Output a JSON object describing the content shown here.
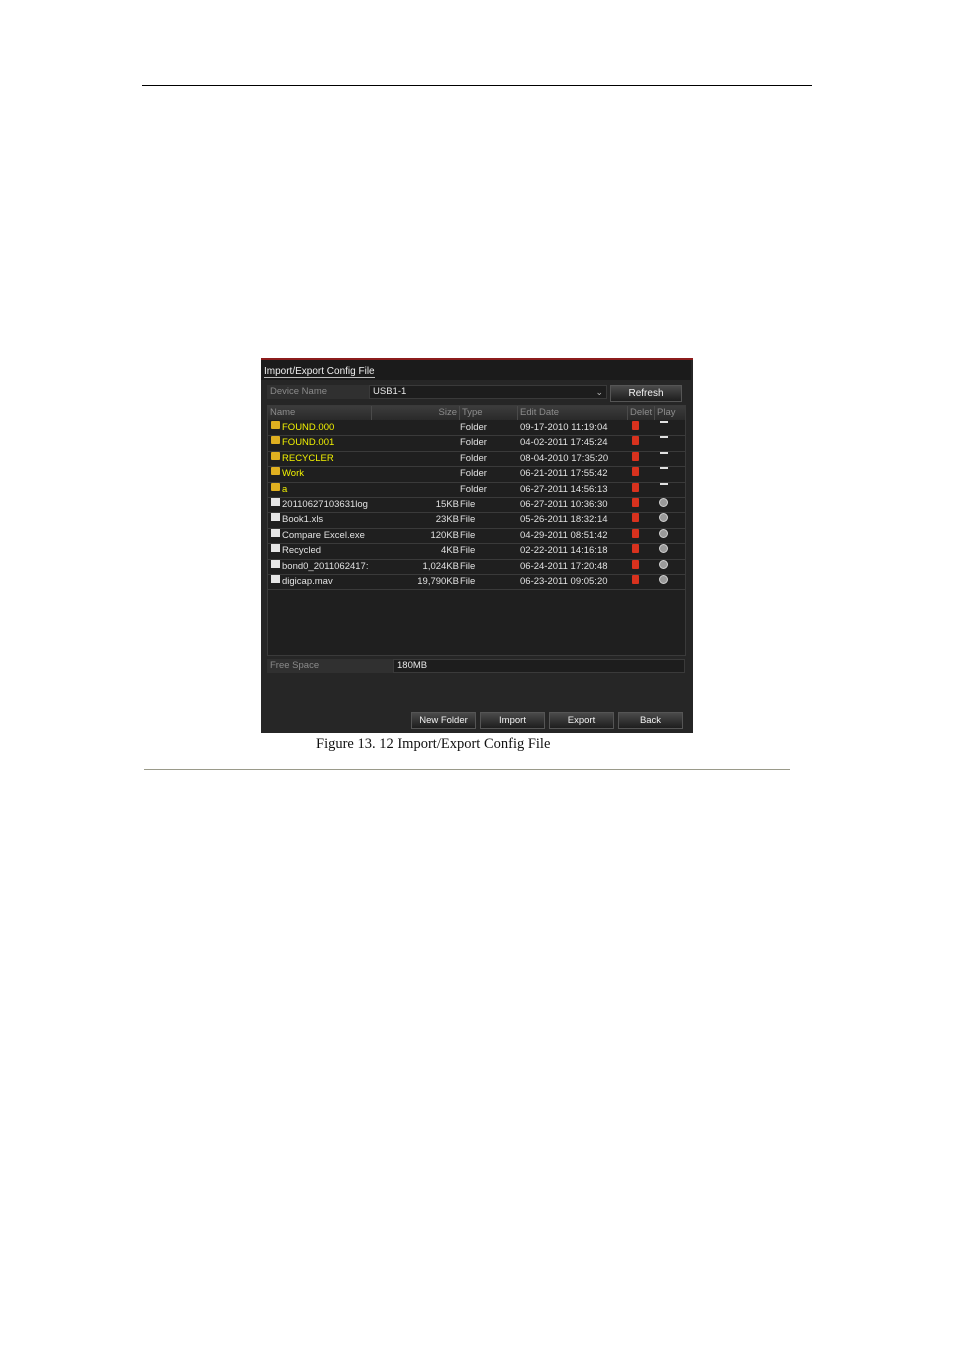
{
  "dialog": {
    "title": "Import/Export Config File",
    "device_label": "Device Name",
    "device_value": "USB1-1",
    "refresh_label": "Refresh",
    "columns": [
      "Name",
      "Size",
      "Type",
      "Edit Date",
      "Delet",
      "Play"
    ],
    "rows": [
      {
        "name": "FOUND.000",
        "size": "",
        "type": "Folder",
        "date": "09-17-2010 11:19:04",
        "kind": "folder"
      },
      {
        "name": "FOUND.001",
        "size": "",
        "type": "Folder",
        "date": "04-02-2011 17:45:24",
        "kind": "folder"
      },
      {
        "name": "RECYCLER",
        "size": "",
        "type": "Folder",
        "date": "08-04-2010 17:35:20",
        "kind": "folder"
      },
      {
        "name": "Work",
        "size": "",
        "type": "Folder",
        "date": "06-21-2011 17:55:42",
        "kind": "folder"
      },
      {
        "name": "a",
        "size": "",
        "type": "Folder",
        "date": "06-27-2011 14:56:13",
        "kind": "folder"
      },
      {
        "name": "20110627103631log",
        "size": "15KB",
        "type": "File",
        "date": "06-27-2011 10:36:30",
        "kind": "file"
      },
      {
        "name": "Book1.xls",
        "size": "23KB",
        "type": "File",
        "date": "05-26-2011 18:32:14",
        "kind": "file"
      },
      {
        "name": "Compare Excel.exe",
        "size": "120KB",
        "type": "File",
        "date": "04-29-2011 08:51:42",
        "kind": "file"
      },
      {
        "name": "Recycled",
        "size": "4KB",
        "type": "File",
        "date": "02-22-2011 14:16:18",
        "kind": "file"
      },
      {
        "name": "bond0_2011062417:",
        "size": "1,024KB",
        "type": "File",
        "date": "06-24-2011 17:20:48",
        "kind": "file"
      },
      {
        "name": "digicap.mav",
        "size": "19,790KB",
        "type": "File",
        "date": "06-23-2011 09:05:20",
        "kind": "file"
      }
    ],
    "free_space_label": "Free Space",
    "free_space_value": "180MB",
    "buttons": [
      "New Folder",
      "Import",
      "Export",
      "Back"
    ]
  },
  "caption": "Figure 13. 12 Import/Export Config File",
  "colors": {
    "folder_text": "#f2f200",
    "title_border": "#8c1c1c",
    "delete_icon": "#d8321e"
  }
}
